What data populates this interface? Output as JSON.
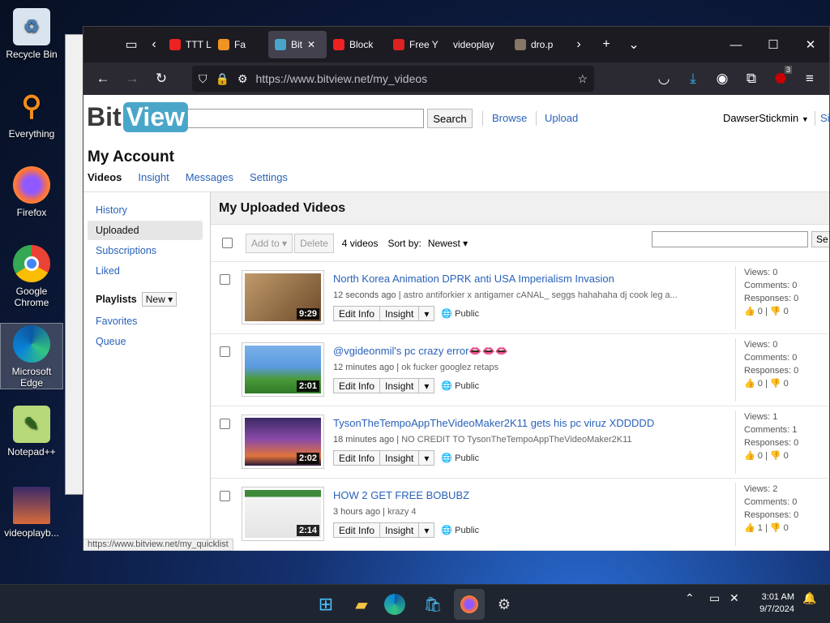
{
  "desktop": {
    "icons": [
      "Recycle Bin",
      "Everything",
      "Firefox",
      "Google Chrome",
      "Microsoft Edge",
      "Notepad++",
      "videoplayb..."
    ]
  },
  "browser": {
    "tabs": [
      "TTT L",
      "Fa",
      "Bit",
      "Block",
      "Free Y",
      "videoplay",
      "dro.p"
    ],
    "url": "https://www.bitview.net/my_videos",
    "notification_badge": "3"
  },
  "site": {
    "logo_bit": "Bit",
    "logo_view": "View",
    "search_button": "Search",
    "nav": {
      "browse": "Browse",
      "upload": "Upload",
      "user": "DawserStickmin",
      "signout": "Si"
    }
  },
  "account": {
    "title": "My Account",
    "tabs": [
      "Videos",
      "Insight",
      "Messages",
      "Settings"
    ]
  },
  "sidebar": {
    "items": [
      "History",
      "Uploaded",
      "Subscriptions",
      "Liked"
    ],
    "playlists_label": "Playlists",
    "new_label": "New",
    "playlist_items": [
      "Favorites",
      "Queue"
    ]
  },
  "main": {
    "heading": "My Uploaded Videos",
    "add_to": "Add to",
    "delete": "Delete",
    "count": "4 videos",
    "sort_by": "Sort by:",
    "sort_value": "Newest",
    "search_btn": "Se",
    "edit_label": "Edit Info",
    "insight_label": "Insight",
    "public_label": "Public"
  },
  "videos": [
    {
      "title": "North Korea Animation DPRK anti USA Imperialism Invasion",
      "time": "12 seconds ago",
      "desc": "astro antiforkier x antigamer cANAL_ seggs hahahaha dj cook leg a...",
      "duration": "9:29",
      "views": "Views: 0",
      "comments": "Comments: 0",
      "responses": "Responses: 0",
      "likes": "0",
      "dislikes": "0"
    },
    {
      "title": "@vgideonmil's pc crazy error👄👄👄",
      "time": "12 minutes ago",
      "desc": "ok fucker googlez retaps",
      "duration": "2:01",
      "views": "Views: 0",
      "comments": "Comments: 0",
      "responses": "Responses: 0",
      "likes": "0",
      "dislikes": "0"
    },
    {
      "title": "TysonTheTempoAppTheVideoMaker2K11 gets his pc viruz XDDDDD",
      "time": "18 minutes ago",
      "desc": "NO CREDIT TO TysonTheTempoAppTheVideoMaker2K11",
      "duration": "2:02",
      "views": "Views: 1",
      "comments": "Comments: 1",
      "responses": "Responses: 0",
      "likes": "0",
      "dislikes": "0"
    },
    {
      "title": "HOW 2 GET FREE BOBUBZ",
      "time": "3 hours ago",
      "desc": "krazy 4",
      "duration": "2:14",
      "views": "Views: 2",
      "comments": "Comments: 0",
      "responses": "Responses: 0",
      "likes": "1",
      "dislikes": "0"
    }
  ],
  "status_url": "https://www.bitview.net/my_quicklist",
  "taskbar": {
    "time": "3:01 AM",
    "date": "9/7/2024"
  }
}
